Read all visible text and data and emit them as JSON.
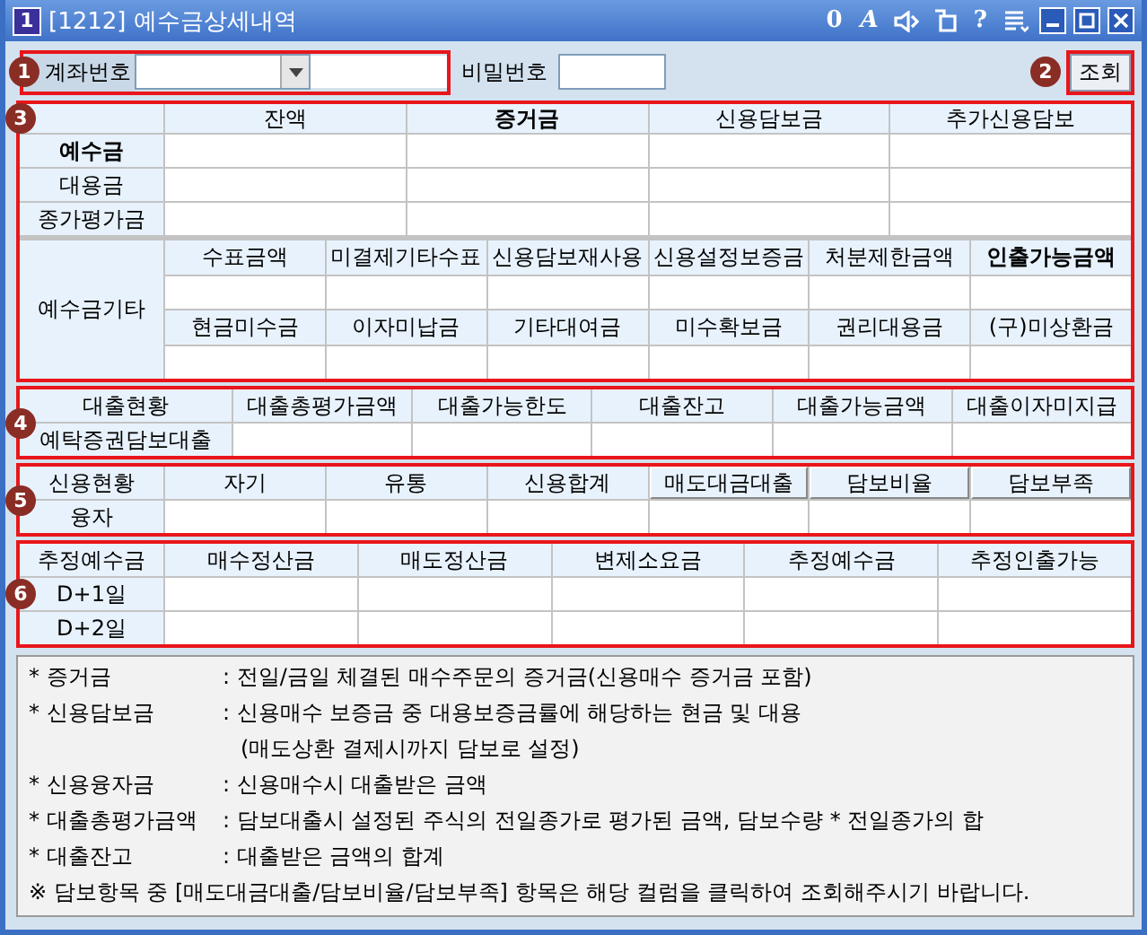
{
  "window": {
    "title": "[1212] 예수금상세내역",
    "icon_text": "1",
    "tool_buttons": [
      "0",
      "A",
      "?"
    ]
  },
  "search": {
    "marker": "1",
    "account_label": "계좌번호",
    "password_label": "비밀번호",
    "query_marker": "2",
    "query_button": "조회"
  },
  "balance": {
    "marker": "3",
    "columns": [
      {
        "label": "잔액",
        "bold": false
      },
      {
        "label": "증거금",
        "bold": true
      },
      {
        "label": "신용담보금",
        "bold": false
      },
      {
        "label": "추가신용담보",
        "bold": false
      }
    ],
    "rows": [
      {
        "label": "예수금",
        "bold": true
      },
      {
        "label": "대용금",
        "bold": false
      },
      {
        "label": "종가평가금",
        "bold": false
      }
    ],
    "other_label": "예수금기타",
    "other_headers": [
      [
        {
          "label": "수표금액",
          "bold": false
        },
        {
          "label": "미결제기타수표",
          "bold": false
        },
        {
          "label": "신용담보재사용",
          "bold": false
        },
        {
          "label": "신용설정보증금",
          "bold": false
        },
        {
          "label": "처분제한금액",
          "bold": false
        },
        {
          "label": "인출가능금액",
          "bold": true
        }
      ],
      [
        {
          "label": "현금미수금",
          "bold": false
        },
        {
          "label": "이자미납금",
          "bold": false
        },
        {
          "label": "기타대여금",
          "bold": false
        },
        {
          "label": "미수확보금",
          "bold": false
        },
        {
          "label": "권리대용금",
          "bold": false
        },
        {
          "label": "(구)미상환금",
          "bold": false
        }
      ]
    ]
  },
  "loans": {
    "marker": "4",
    "columns": [
      "대출현황",
      "대출총평가금액",
      "대출가능한도",
      "대출잔고",
      "대출가능금액",
      "대출이자미지급"
    ],
    "rows": [
      "예탁증권담보대출"
    ]
  },
  "credit": {
    "marker": "5",
    "columns": [
      {
        "label": "신용현황",
        "kind": "label"
      },
      {
        "label": "자기",
        "kind": "header"
      },
      {
        "label": "유통",
        "kind": "header"
      },
      {
        "label": "신용합계",
        "kind": "header"
      },
      {
        "label": "매도대금대출",
        "kind": "button"
      },
      {
        "label": "담보비율",
        "kind": "button"
      },
      {
        "label": "담보부족",
        "kind": "button"
      }
    ],
    "rows": [
      "융자"
    ]
  },
  "estimates": {
    "marker": "6",
    "columns": [
      "추정예수금",
      "매수정산금",
      "매도정산금",
      "변제소요금",
      "추정예수금",
      "추정인출가능"
    ],
    "rows": [
      "D+1일",
      "D+2일"
    ]
  },
  "notes": [
    {
      "term": "* 증거금",
      "text": ": 전일/금일 체결된 매수주문의 증거금(신용매수 증거금 포함)"
    },
    {
      "term": "* 신용담보금",
      "text": ": 신용매수 보증금 중 대용보증금률에 해당하는 현금 및 대용"
    },
    {
      "text": "(매도상환 결제시까지 담보로 설정)"
    },
    {
      "term": "* 신용융자금",
      "text": ": 신용매수시 대출받은 금액"
    },
    {
      "term": "* 대출총평가금액",
      "text": ": 담보대출시 설정된 주식의 전일종가로 평가된 금액, 담보수량 * 전일종가의 합"
    },
    {
      "term": "* 대출잔고",
      "text": ": 대출받은 금액의 합계"
    }
  ],
  "footnote": "※ 담보항목 중 [매도대금대출/담보비율/담보부족] 항목은 해당 컬럼을 클릭하여 조회해주시기 바랍니다."
}
